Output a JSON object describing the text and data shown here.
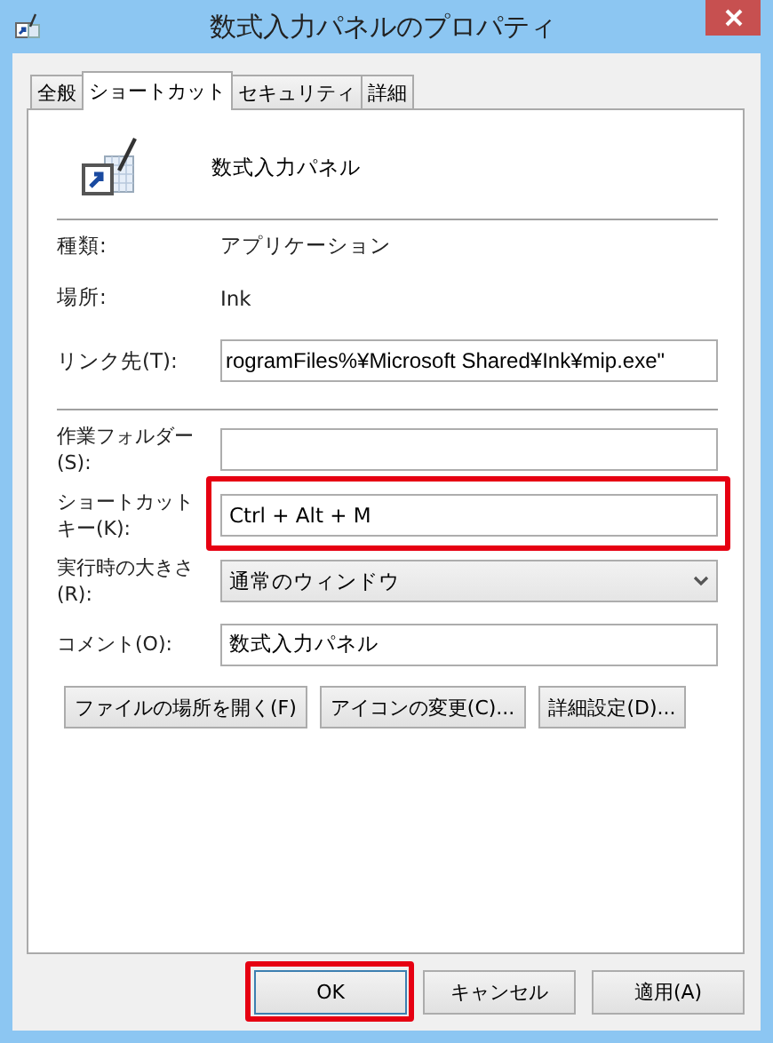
{
  "window": {
    "title": "数式入力パネルのプロパティ"
  },
  "tabs": [
    {
      "label": "全般",
      "selected": false
    },
    {
      "label": "ショートカット",
      "selected": true
    },
    {
      "label": "セキュリティ",
      "selected": false
    },
    {
      "label": "詳細",
      "selected": false
    }
  ],
  "header": {
    "name": "数式入力パネル"
  },
  "info": [
    {
      "label": "種類:",
      "value": "アプリケーション"
    },
    {
      "label": "場所:",
      "value": "Ink"
    }
  ],
  "target": {
    "label": "リンク先(T):",
    "value": "rogramFiles%¥Microsoft Shared¥Ink¥mip.exe\""
  },
  "fields": [
    {
      "kind": "text",
      "label": "作業フォルダー(S):",
      "highlighted": false
    },
    {
      "kind": "text",
      "label": "ショートカットキー(K):",
      "value": "Ctrl + Alt + M",
      "highlighted": true
    },
    {
      "kind": "select",
      "label": "実行時の大きさ(R):",
      "value": "通常のウィンドウ",
      "highlighted": false
    },
    {
      "kind": "text",
      "label": "コメント(O):",
      "value": "数式入力パネル",
      "highlighted": false
    }
  ],
  "action_buttons": [
    "ファイルの場所を開く(F)",
    "アイコンの変更(C)...",
    "詳細設定(D)..."
  ],
  "dialog_buttons": [
    {
      "label": "OK",
      "default": true,
      "highlighted": true
    },
    {
      "label": "キャンセル",
      "default": false,
      "highlighted": false
    },
    {
      "label": "適用(A)",
      "default": false,
      "highlighted": false
    }
  ]
}
